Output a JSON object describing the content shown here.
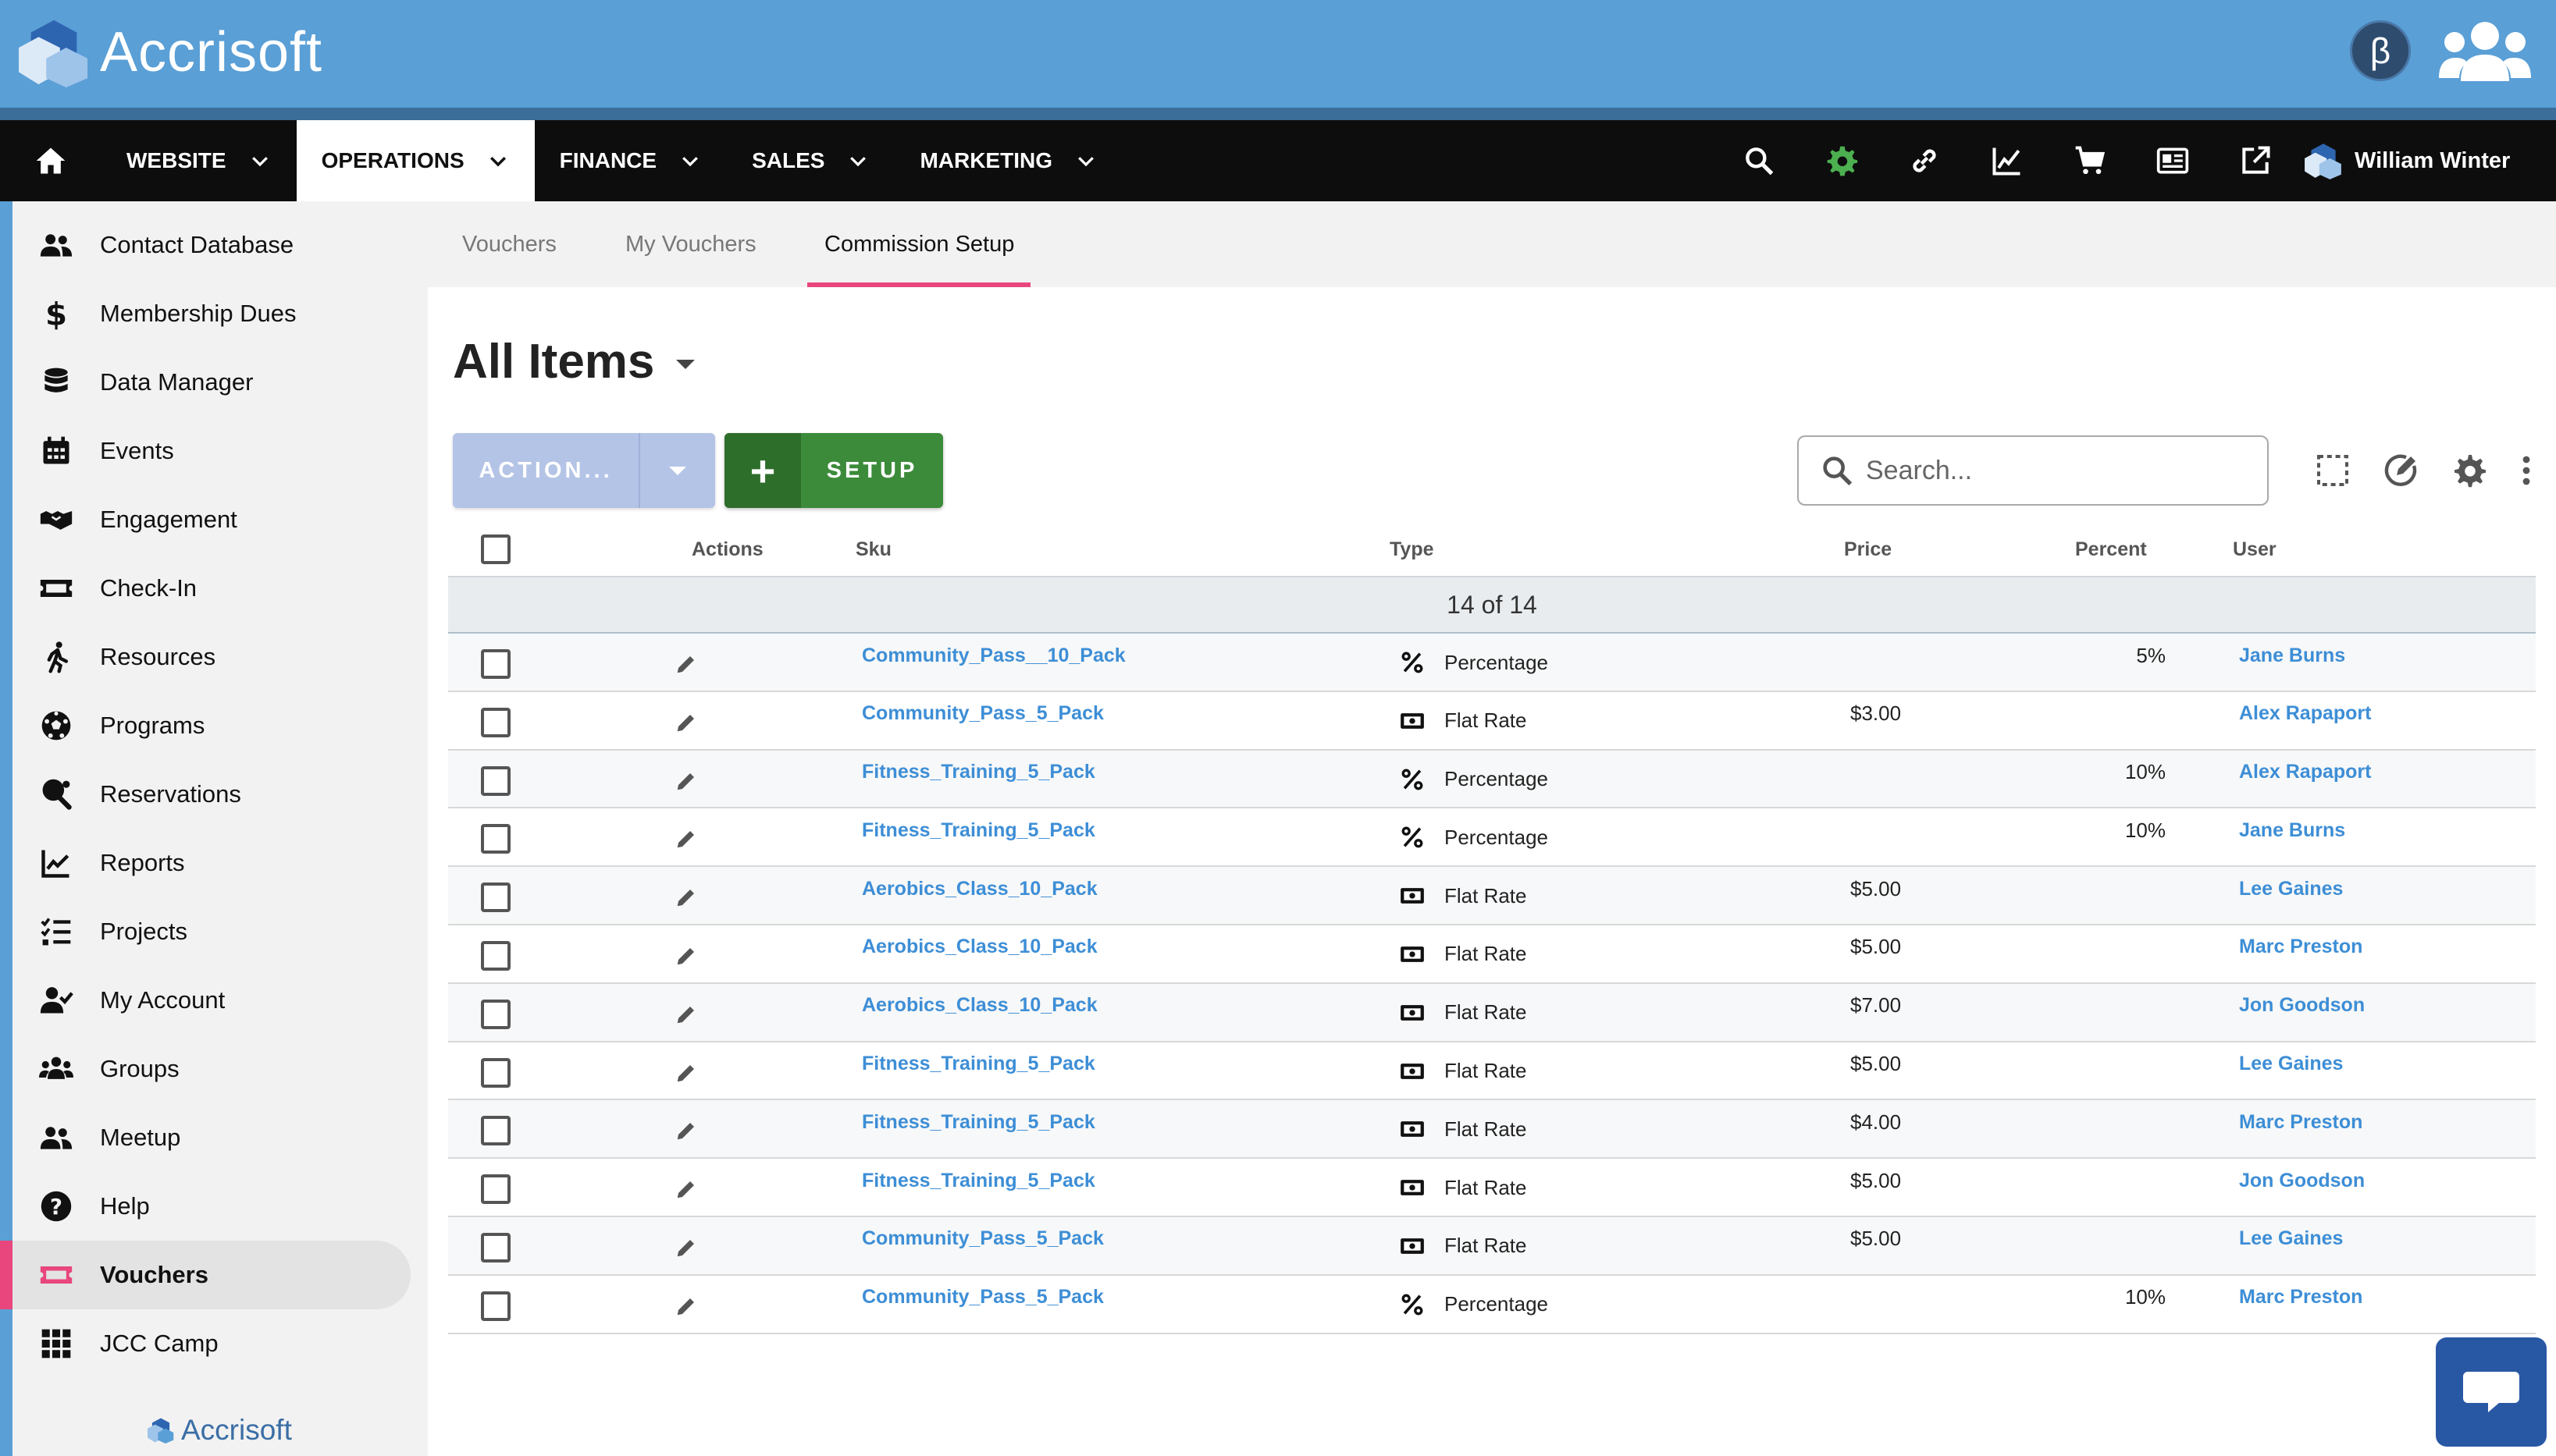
{
  "app": {
    "brand": "Accrisoft",
    "beta_label": "β"
  },
  "nav": {
    "items": [
      {
        "label": "WEBSITE",
        "active": false
      },
      {
        "label": "OPERATIONS",
        "active": true
      },
      {
        "label": "FINANCE",
        "active": false
      },
      {
        "label": "SALES",
        "active": false
      },
      {
        "label": "MARKETING",
        "active": false
      }
    ],
    "icons": [
      "search-icon",
      "gear-icon",
      "link-icon",
      "chart-line-icon",
      "cart-icon",
      "newspaper-icon",
      "external-link-icon"
    ],
    "user_name": "William Winter",
    "settings_icon_color": "#4caf50"
  },
  "sidebar": {
    "items": [
      {
        "label": "Contact Database",
        "icon": "contacts-icon"
      },
      {
        "label": "Membership Dues",
        "icon": "dollar-icon"
      },
      {
        "label": "Data Manager",
        "icon": "database-icon"
      },
      {
        "label": "Events",
        "icon": "calendar-icon"
      },
      {
        "label": "Engagement",
        "icon": "handshake-icon"
      },
      {
        "label": "Check-In",
        "icon": "ticket-icon"
      },
      {
        "label": "Resources",
        "icon": "running-icon"
      },
      {
        "label": "Programs",
        "icon": "soccer-ball-icon"
      },
      {
        "label": "Reservations",
        "icon": "ping-pong-icon"
      },
      {
        "label": "Reports",
        "icon": "chart-icon"
      },
      {
        "label": "Projects",
        "icon": "tasks-icon"
      },
      {
        "label": "My Account",
        "icon": "user-check-icon"
      },
      {
        "label": "Groups",
        "icon": "groups-icon"
      },
      {
        "label": "Meetup",
        "icon": "meetup-icon"
      },
      {
        "label": "Help",
        "icon": "help-icon"
      },
      {
        "label": "Vouchers",
        "icon": "voucher-icon",
        "active": true
      },
      {
        "label": "JCC Camp",
        "icon": "grid-icon"
      }
    ],
    "footer_brand": "Accrisoft",
    "active_color": "#e8467c"
  },
  "subtabs": [
    {
      "label": "Vouchers",
      "active": false
    },
    {
      "label": "My Vouchers",
      "active": false
    },
    {
      "label": "Commission Setup",
      "active": true
    }
  ],
  "page": {
    "title": "All Items",
    "action_label": "ACTION...",
    "setup_label": "SETUP",
    "setup_plus": "+",
    "search_placeholder": "Search..."
  },
  "table": {
    "columns": {
      "actions": "Actions",
      "sku": "Sku",
      "type": "Type",
      "price": "Price",
      "percent": "Percent",
      "user": "User"
    },
    "count_text": "14 of 14",
    "rows": [
      {
        "sku": "Community_Pass__10_Pack",
        "type": "Percentage",
        "price": "",
        "percent": "5%",
        "user": "Jane Burns"
      },
      {
        "sku": "Community_Pass_5_Pack",
        "type": "Flat Rate",
        "price": "$3.00",
        "percent": "",
        "user": "Alex Rapaport"
      },
      {
        "sku": "Fitness_Training_5_Pack",
        "type": "Percentage",
        "price": "",
        "percent": "10%",
        "user": "Alex Rapaport"
      },
      {
        "sku": "Fitness_Training_5_Pack",
        "type": "Percentage",
        "price": "",
        "percent": "10%",
        "user": "Jane Burns"
      },
      {
        "sku": "Aerobics_Class_10_Pack",
        "type": "Flat Rate",
        "price": "$5.00",
        "percent": "",
        "user": "Lee Gaines"
      },
      {
        "sku": "Aerobics_Class_10_Pack",
        "type": "Flat Rate",
        "price": "$5.00",
        "percent": "",
        "user": "Marc Preston"
      },
      {
        "sku": "Aerobics_Class_10_Pack",
        "type": "Flat Rate",
        "price": "$7.00",
        "percent": "",
        "user": "Jon Goodson"
      },
      {
        "sku": "Fitness_Training_5_Pack",
        "type": "Flat Rate",
        "price": "$5.00",
        "percent": "",
        "user": "Lee Gaines"
      },
      {
        "sku": "Fitness_Training_5_Pack",
        "type": "Flat Rate",
        "price": "$4.00",
        "percent": "",
        "user": "Marc Preston"
      },
      {
        "sku": "Fitness_Training_5_Pack",
        "type": "Flat Rate",
        "price": "$5.00",
        "percent": "",
        "user": "Jon Goodson"
      },
      {
        "sku": "Community_Pass_5_Pack",
        "type": "Flat Rate",
        "price": "$5.00",
        "percent": "",
        "user": "Lee Gaines"
      },
      {
        "sku": "Community_Pass_5_Pack",
        "type": "Percentage",
        "price": "",
        "percent": "10%",
        "user": "Marc Preston"
      }
    ]
  }
}
